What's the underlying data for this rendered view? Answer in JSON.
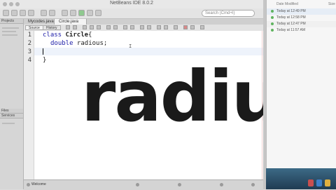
{
  "window": {
    "title": "NetBeans IDE 8.0.2"
  },
  "search": {
    "placeholder": "Search (Cmd+I)"
  },
  "left_panel": {
    "tabs": [
      "Projects",
      "Files",
      "Services"
    ]
  },
  "file_tabs": [
    {
      "label": "Mycodes.java",
      "active": false
    },
    {
      "label": "Circle.java",
      "active": true
    }
  ],
  "editor_toolbar": {
    "source_label": "Source",
    "history_label": "History"
  },
  "editor": {
    "line_numbers": [
      "1",
      "2",
      "3",
      "4"
    ],
    "lines": [
      {
        "keyword": "class",
        "rest": " ",
        "bold": "Circle",
        "tail": "{"
      },
      {
        "keyword": "double",
        "rest": " radious;",
        "bold": "",
        "tail": ""
      },
      {
        "keyword": "",
        "rest": "",
        "bold": "",
        "tail": ""
      },
      {
        "keyword": "",
        "rest": "}",
        "bold": "",
        "tail": ""
      }
    ]
  },
  "overlay_word": "radius",
  "bottom_bar": {
    "tab_label": "Welcome"
  },
  "right_panel": {
    "col_date": "Date Modified",
    "col_size": "Size",
    "rows": [
      {
        "date": "Today at 12:49 PM",
        "size": ""
      },
      {
        "date": "Today at 12:58 PM",
        "size": ""
      },
      {
        "date": "Today at 12:47 PM",
        "size": ""
      },
      {
        "date": "Today at 11:57 AM",
        "size": ""
      }
    ]
  },
  "colors": {
    "keyword": "#1a1aa6",
    "status_dot": "#5fb35f",
    "overlay_text": "#1a1a1a"
  }
}
